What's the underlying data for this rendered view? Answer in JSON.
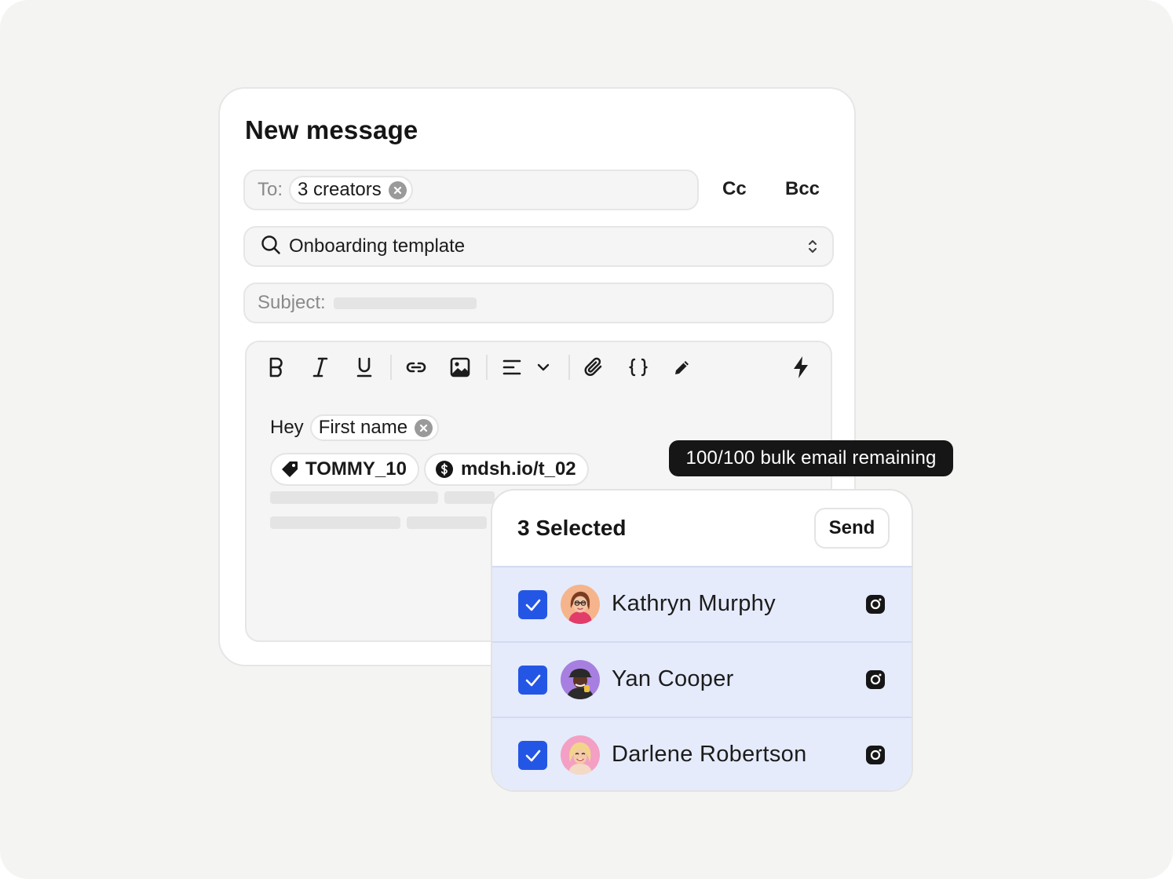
{
  "compose": {
    "title": "New message",
    "to_label": "To:",
    "to_chip": "3 creators",
    "cc_label": "Cc",
    "bcc_label": "Bcc",
    "template_value": "Onboarding template",
    "subject_label": "Subject:",
    "greeting": "Hey",
    "first_name_chip": "First name",
    "tags": [
      {
        "label": "TOMMY_10",
        "icon": "tag-icon"
      },
      {
        "label": "mdsh.io/t_02",
        "icon": "dollar-icon"
      }
    ],
    "toolbar_icons": [
      "bold-icon",
      "italic-icon",
      "underline-icon",
      "link-icon",
      "image-icon",
      "align-icon",
      "chevron-down-icon",
      "paperclip-icon",
      "braces-icon",
      "pen-icon",
      "lightning-icon"
    ]
  },
  "tooltip": {
    "text": "100/100 bulk email remaining"
  },
  "panel": {
    "title": "3 Selected",
    "send_label": "Send",
    "rows": [
      {
        "name": "Kathryn Murphy",
        "checked": true,
        "platform": "instagram-icon"
      },
      {
        "name": "Yan Cooper",
        "checked": true,
        "platform": "instagram-icon"
      },
      {
        "name": "Darlene Robertson",
        "checked": true,
        "platform": "instagram-icon"
      }
    ]
  },
  "colors": {
    "accent": "#2456e6",
    "selected_row": "#e5ebfb",
    "tooltip_bg": "#161616"
  }
}
